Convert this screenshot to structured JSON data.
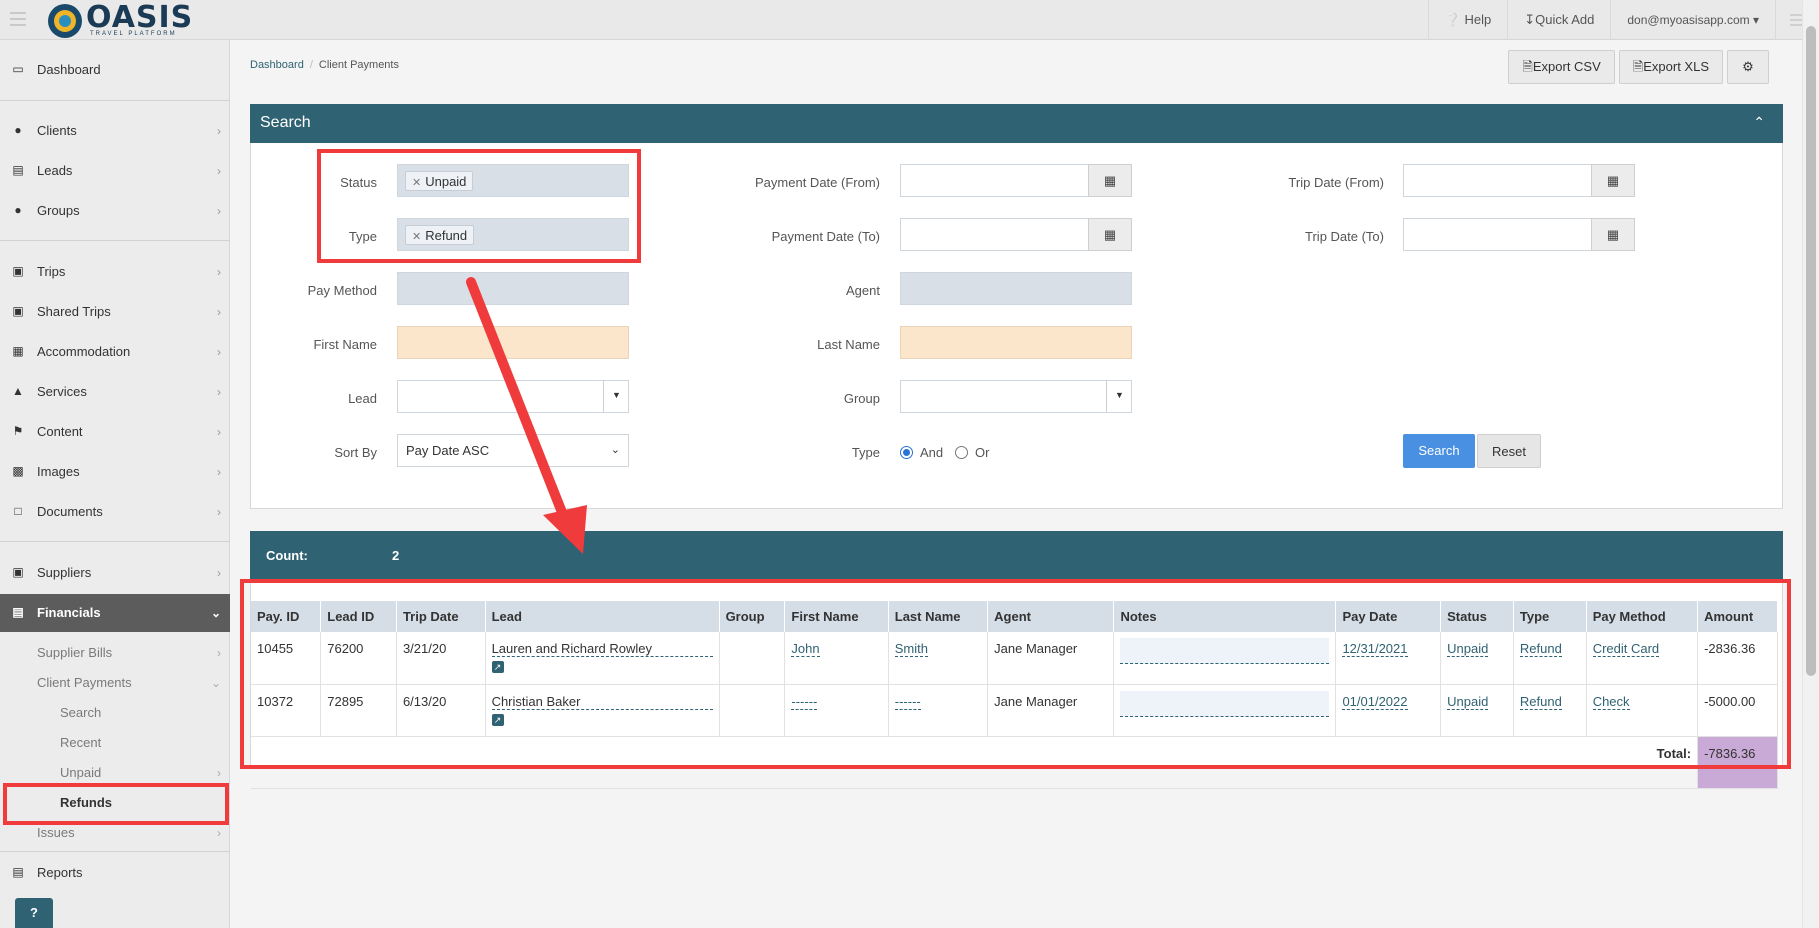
{
  "topbar": {
    "logo_text": "OASIS",
    "logo_sub": "TRAVEL PLATFORM",
    "help": "Help",
    "quick_add": "Quick Add",
    "user": "don@myoasisapp.com"
  },
  "sidebar": {
    "items": [
      {
        "label": "Dashboard",
        "icon": "monitor-icon"
      },
      {
        "label": "Clients",
        "icon": "user-icon"
      },
      {
        "label": "Leads",
        "icon": "inbox-icon"
      },
      {
        "label": "Groups",
        "icon": "users-icon"
      },
      {
        "label": "Trips",
        "icon": "suitcase-icon"
      },
      {
        "label": "Shared Trips",
        "icon": "suitcase-icon"
      },
      {
        "label": "Accommodation",
        "icon": "building-icon"
      },
      {
        "label": "Services",
        "icon": "binoculars-icon"
      },
      {
        "label": "Content",
        "icon": "flag-icon"
      },
      {
        "label": "Images",
        "icon": "image-icon"
      },
      {
        "label": "Documents",
        "icon": "file-icon"
      },
      {
        "label": "Suppliers",
        "icon": "briefcase-icon"
      },
      {
        "label": "Financials",
        "icon": "money-icon"
      },
      {
        "label": "Reports",
        "icon": "list-icon"
      }
    ],
    "sub_items": [
      "Supplier Bills",
      "Client Payments",
      "Search",
      "Recent",
      "Unpaid",
      "Refunds",
      "Issues"
    ],
    "help_label": "?"
  },
  "breadcrumb": {
    "home": "Dashboard",
    "current": "Client Payments"
  },
  "actions": {
    "export_csv": "Export CSV",
    "export_xls": "Export XLS"
  },
  "search": {
    "title": "Search",
    "status_label": "Status",
    "status_tag": "Unpaid",
    "type_label": "Type",
    "type_tag": "Refund",
    "pay_method_label": "Pay Method",
    "first_name_label": "First Name",
    "lead_label": "Lead",
    "sort_by_label": "Sort By",
    "sort_by_value": "Pay Date ASC",
    "payment_date_from_label": "Payment Date (From)",
    "payment_date_to_label": "Payment Date (To)",
    "agent_label": "Agent",
    "last_name_label": "Last Name",
    "group_label": "Group",
    "type_mode_label": "Type",
    "type_mode_and": "And",
    "type_mode_or": "Or",
    "trip_date_from_label": "Trip Date (From)",
    "trip_date_to_label": "Trip Date (To)",
    "search_button": "Search",
    "reset_button": "Reset"
  },
  "results": {
    "count_label": "Count:",
    "count_value": "2",
    "columns": [
      "Pay. ID",
      "Lead ID",
      "Trip Date",
      "Lead",
      "Group",
      "First Name",
      "Last Name",
      "Agent",
      "Notes",
      "Pay Date",
      "Status",
      "Type",
      "Pay Method",
      "Amount"
    ],
    "rows": [
      {
        "pay_id": "10455",
        "lead_id": "76200",
        "trip_date": "3/21/20",
        "lead": "Lauren and Richard Rowley",
        "group": "",
        "first_name": "John",
        "last_name": "Smith",
        "agent": "Jane Manager",
        "notes": "",
        "pay_date": "12/31/2021",
        "status": "Unpaid",
        "type": "Refund",
        "pay_method": "Credit Card",
        "amount": "-2836.36"
      },
      {
        "pay_id": "10372",
        "lead_id": "72895",
        "trip_date": "6/13/20",
        "lead": "Christian Baker",
        "group": "",
        "first_name": "------",
        "last_name": "------",
        "agent": "Jane Manager",
        "notes": "",
        "pay_date": "01/01/2022",
        "status": "Unpaid",
        "type": "Refund",
        "pay_method": "Check",
        "amount": "-5000.00"
      }
    ],
    "total_label": "Total:",
    "total_value": "-7836.36"
  },
  "colors": {
    "header": "#2f6272",
    "annotation": "#ef3b3b",
    "search_button": "#4a90e2",
    "total_highlight": "#c9a9d6"
  }
}
